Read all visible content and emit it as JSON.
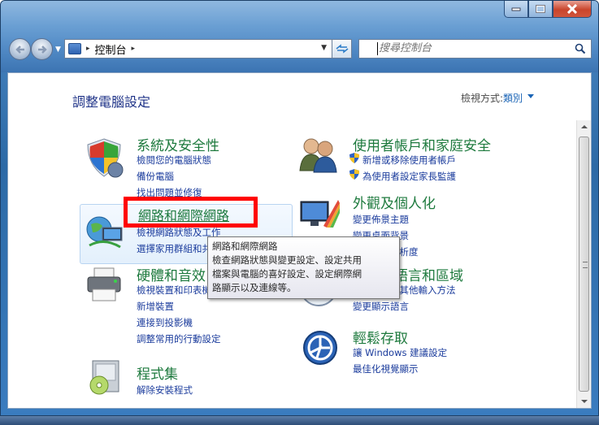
{
  "window": {
    "address": {
      "segment": "控制台",
      "sep1": "▸",
      "sep2": "▸"
    },
    "search_placeholder": "搜尋控制台",
    "buttons": {
      "minimize": "minimize",
      "maximize": "maximize",
      "close": "close"
    }
  },
  "page": {
    "title": "調整電腦設定",
    "view_by_label": "檢視方式:",
    "view_by_value": "類別"
  },
  "categories": {
    "system": {
      "title": "系統及安全性",
      "links": [
        "檢閱您的電腦狀態",
        "備份電腦",
        "找出問題並修復"
      ]
    },
    "network": {
      "title": "網路和網際網路",
      "links": [
        "檢視網路狀態及工作",
        "選擇家用群組和共用選項"
      ]
    },
    "hardware": {
      "title": "硬體和音效",
      "links": [
        "檢視裝置和印表機",
        "新增裝置",
        "連接到投影機",
        "調整常用的行動設定"
      ]
    },
    "programs": {
      "title": "程式集",
      "links": [
        "解除安裝程式"
      ]
    },
    "users": {
      "title": "使用者帳戶和家庭安全",
      "links": [
        "新增或移除使用者帳戶",
        "為使用者設定家長監護"
      ]
    },
    "appearance": {
      "title": "外觀及個人化",
      "links": [
        "變更佈景主題",
        "變更桌面背景",
        "調整螢幕解析度"
      ]
    },
    "clock": {
      "title": "時鐘、語言和區域",
      "links": [
        "變更鍵盤或其他輸入方法",
        "變更顯示語言"
      ]
    },
    "ease": {
      "title": "輕鬆存取",
      "links": [
        "讓 Windows 建議設定",
        "最佳化視覺顯示"
      ]
    }
  },
  "tooltip": {
    "title": "網路和網際網路",
    "lines": [
      "檢查網路狀態與變更設定、設定共用",
      "檔案與電腦的喜好設定、設定網際網",
      "路顯示以及連線等。"
    ]
  }
}
